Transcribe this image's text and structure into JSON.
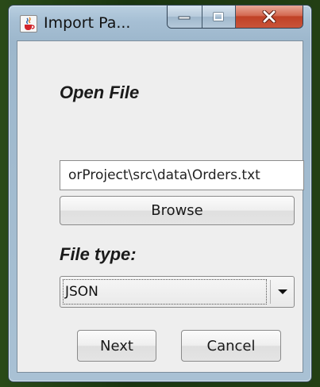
{
  "window": {
    "title": "Import Pa...",
    "icons": {
      "app": "java-cup-icon",
      "minimize": "minimize-icon",
      "maximize": "maximize-icon",
      "close": "close-icon"
    }
  },
  "open_file": {
    "heading": "Open File",
    "path_value": "orProject\\src\\data\\Orders.txt",
    "browse_label": "Browse"
  },
  "file_type": {
    "heading": "File type:",
    "selected": "JSON",
    "dropdown_icon": "chevron-down-icon"
  },
  "actions": {
    "next_label": "Next",
    "cancel_label": "Cancel"
  },
  "colors": {
    "close_button": "#c9543a",
    "window_frame": "#a9c1d4",
    "client_background": "#eeeeee"
  }
}
